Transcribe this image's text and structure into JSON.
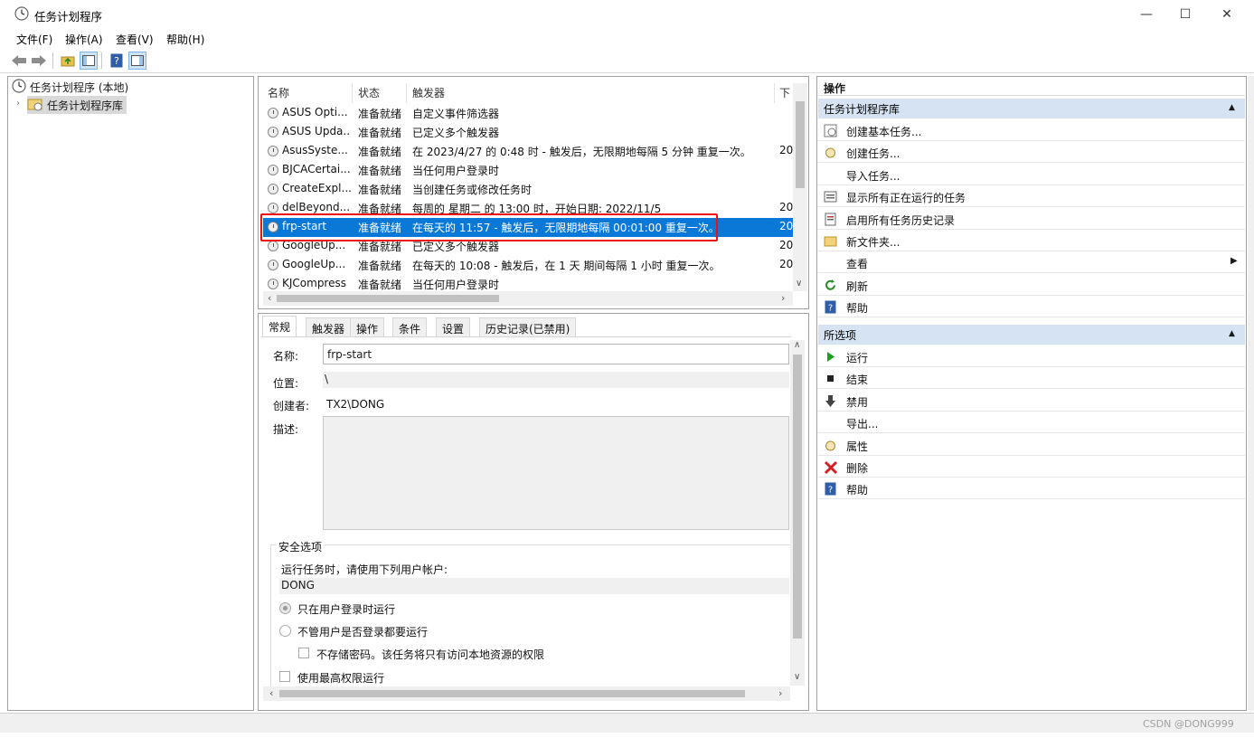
{
  "window": {
    "title": "任务计划程序",
    "minimize": "—",
    "maximize": "☐",
    "close": "✕"
  },
  "menu": [
    "文件(F)",
    "操作(A)",
    "查看(V)",
    "帮助(H)"
  ],
  "tree": {
    "root": "任务计划程序 (本地)",
    "child": "任务计划程序库"
  },
  "table": {
    "columns": [
      "名称",
      "状态",
      "触发器",
      "下"
    ],
    "rows": [
      {
        "name": "ASUS Opti...",
        "status": "准备就绪",
        "trigger": "自定义事件筛选器",
        "next": ""
      },
      {
        "name": "ASUS Upda...",
        "status": "准备就绪",
        "trigger": "已定义多个触发器",
        "next": ""
      },
      {
        "name": "AsusSyste...",
        "status": "准备就绪",
        "trigger": "在 2023/4/27 的 0:48 时 - 触发后，无限期地每隔 5 分钟 重复一次。",
        "next": "20"
      },
      {
        "name": "BJCACertai...",
        "status": "准备就绪",
        "trigger": "当任何用户登录时",
        "next": ""
      },
      {
        "name": "CreateExpl...",
        "status": "准备就绪",
        "trigger": "当创建任务或修改任务时",
        "next": ""
      },
      {
        "name": "delBeyond...",
        "status": "准备就绪",
        "trigger": "每周的 星期二 的 13:00 时，开始日期: 2022/11/5",
        "next": "20"
      },
      {
        "name": "frp-start",
        "status": "准备就绪",
        "trigger": "在每天的 11:57 - 触发后，无限期地每隔 00:01:00 重复一次。",
        "next": "20"
      },
      {
        "name": "GoogleUp...",
        "status": "准备就绪",
        "trigger": "已定义多个触发器",
        "next": "20"
      },
      {
        "name": "GoogleUp...",
        "status": "准备就绪",
        "trigger": "在每天的 10:08 - 触发后，在 1 天 期间每隔 1 小时 重复一次。",
        "next": "20"
      },
      {
        "name": "KJCompress",
        "status": "准备就绪",
        "trigger": "当任何用户登录时",
        "next": ""
      }
    ]
  },
  "tabs": [
    "常规",
    "触发器",
    "操作",
    "条件",
    "设置",
    "历史记录(已禁用)"
  ],
  "general": {
    "name_label": "名称:",
    "name_value": "frp-start",
    "location_label": "位置:",
    "location_value": "\\",
    "author_label": "创建者:",
    "author_value": "TX2\\DONG",
    "desc_label": "描述:",
    "security_title": "安全选项",
    "run_as_text": "运行任务时，请使用下列用户帐户:",
    "user": "DONG",
    "radio1": "只在用户登录时运行",
    "radio2": "不管用户是否登录都要运行",
    "nostore": "不存储密码。该任务将只有访问本地资源的权限",
    "highest": "使用最高权限运行"
  },
  "actions": {
    "title": "操作",
    "section1": "任务计划程序库",
    "items1": [
      {
        "icon": "create-basic-task-icon",
        "label": "创建基本任务..."
      },
      {
        "icon": "create-task-icon",
        "label": "创建任务..."
      },
      {
        "icon": "",
        "label": "导入任务..."
      },
      {
        "icon": "running-tasks-icon",
        "label": "显示所有正在运行的任务"
      },
      {
        "icon": "history-icon",
        "label": "启用所有任务历史记录"
      },
      {
        "icon": "new-folder-icon",
        "label": "新文件夹..."
      },
      {
        "icon": "",
        "label": "查看"
      },
      {
        "icon": "refresh-icon",
        "label": "刷新"
      },
      {
        "icon": "help-icon",
        "label": "帮助"
      }
    ],
    "section2": "所选项",
    "items2": [
      {
        "icon": "run-icon",
        "label": "运行"
      },
      {
        "icon": "end-icon",
        "label": "结束"
      },
      {
        "icon": "disable-icon",
        "label": "禁用"
      },
      {
        "icon": "",
        "label": "导出..."
      },
      {
        "icon": "properties-icon",
        "label": "属性"
      },
      {
        "icon": "delete-icon",
        "label": "删除"
      },
      {
        "icon": "help-icon",
        "label": "帮助"
      }
    ]
  },
  "watermark": "CSDN @DONG999"
}
